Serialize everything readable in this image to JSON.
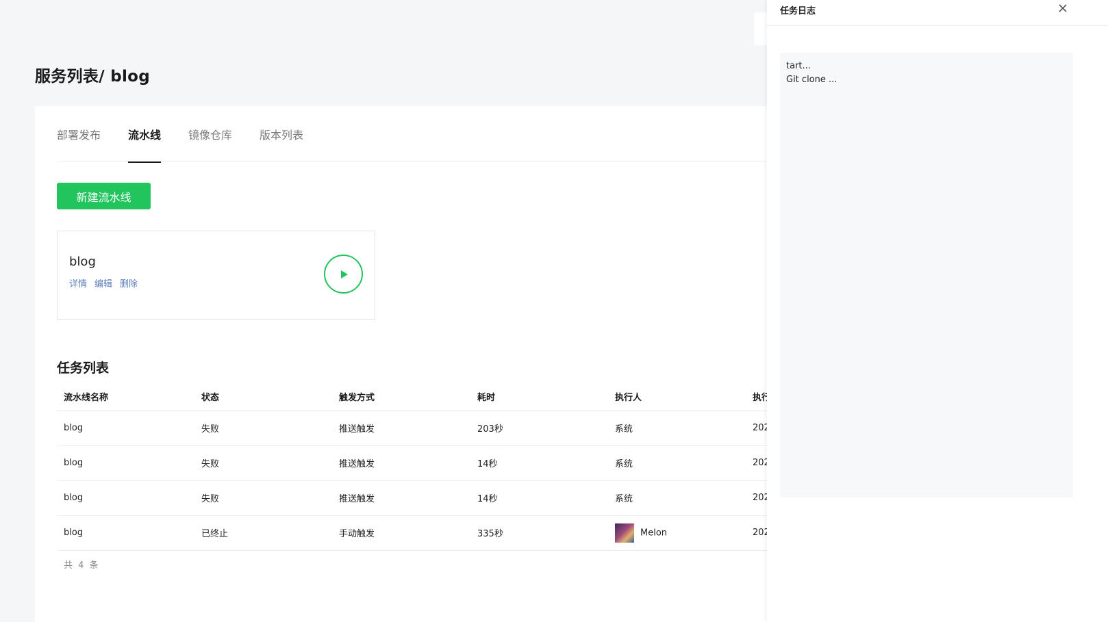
{
  "page": {
    "title": "服务列表/ blog"
  },
  "tabs": [
    {
      "label": "部署发布"
    },
    {
      "label": "流水线"
    },
    {
      "label": "镜像仓库"
    },
    {
      "label": "版本列表"
    }
  ],
  "toolbar": {
    "new_pipeline_label": "新建流水线"
  },
  "pipeline_card": {
    "name": "blog",
    "actions": {
      "detail": "详情",
      "edit": "编辑",
      "delete": "删除"
    },
    "run_icon": "play-icon"
  },
  "tasks": {
    "title": "任务列表",
    "columns": [
      "流水线名称",
      "状态",
      "触发方式",
      "耗时",
      "执行人",
      "执行"
    ],
    "rows": [
      {
        "name": "blog",
        "status": "失败",
        "trigger": "推送触发",
        "duration": "203秒",
        "executor": "系统",
        "time": "202"
      },
      {
        "name": "blog",
        "status": "失败",
        "trigger": "推送触发",
        "duration": "14秒",
        "executor": "系统",
        "time": "202"
      },
      {
        "name": "blog",
        "status": "失败",
        "trigger": "推送触发",
        "duration": "14秒",
        "executor": "系统",
        "time": "202"
      },
      {
        "name": "blog",
        "status": "已终止",
        "trigger": "手动触发",
        "duration": "335秒",
        "executor": "Melon",
        "time": "202"
      }
    ],
    "total": "共 4 条"
  },
  "drawer": {
    "title": "任务日志",
    "close_icon": "close-icon",
    "log_lines": [
      "tart...",
      "Git clone ..."
    ]
  },
  "colors": {
    "accent": "#21c45d",
    "link": "#5a7db8",
    "background": "#f5f6f8"
  }
}
